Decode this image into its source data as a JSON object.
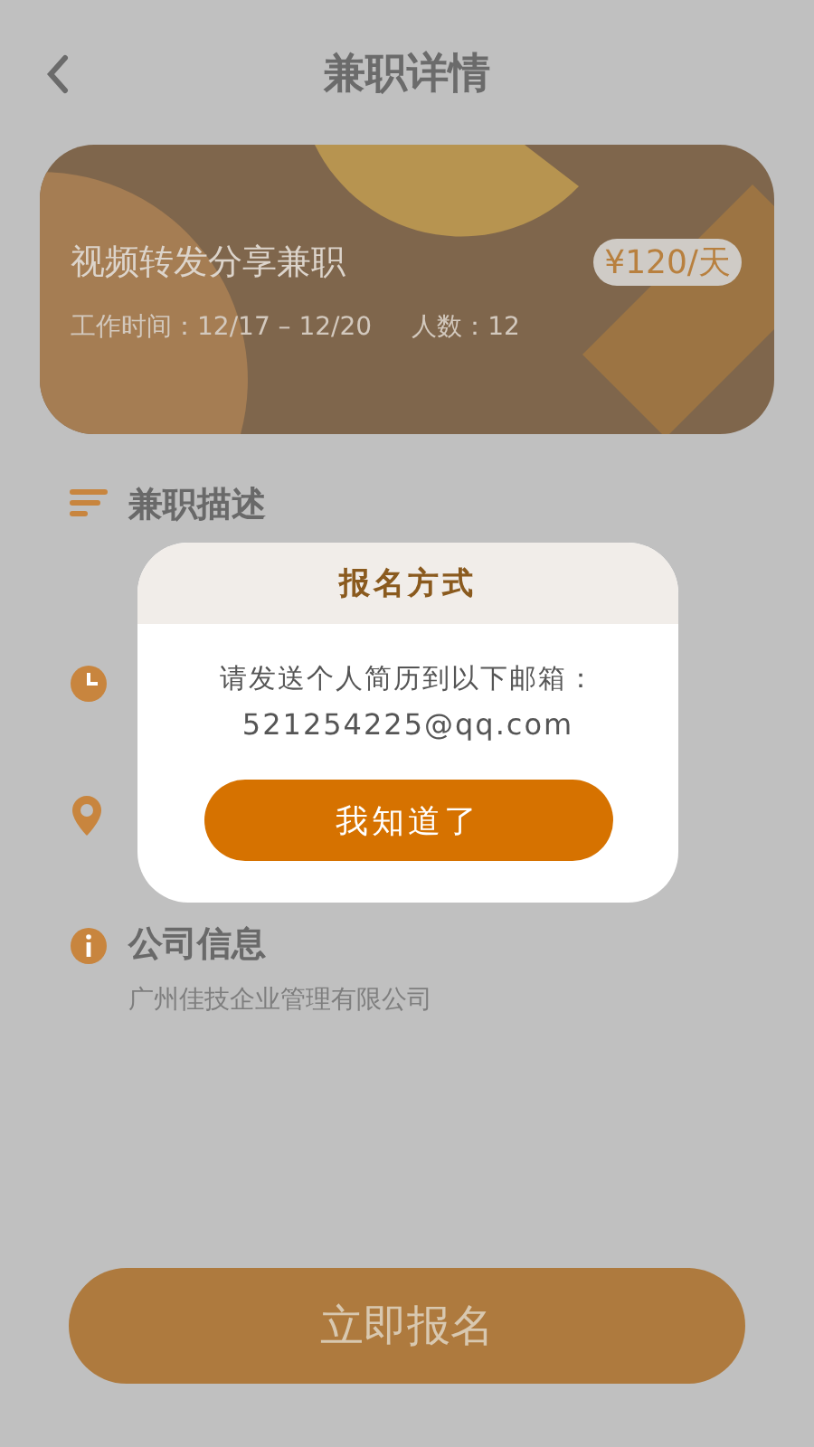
{
  "header": {
    "title": "兼职详情"
  },
  "job": {
    "title": "视频转发分享兼职",
    "price": "¥120/天",
    "time": "工作时间：12/17 – 12/20",
    "headcount": "人数：12"
  },
  "sections": [
    {
      "kind": "lines",
      "title": "兼职描述"
    },
    {
      "kind": "clock"
    },
    {
      "kind": "pin"
    },
    {
      "kind": "info",
      "title": "公司信息",
      "description": "广州佳技企业管理有限公司"
    }
  ],
  "dialog": {
    "title": "报名方式",
    "message": "请发送个人简历到以下邮箱：",
    "email": "521254225@qq.com",
    "button": "我知道了"
  },
  "apply_button": "立即报名"
}
